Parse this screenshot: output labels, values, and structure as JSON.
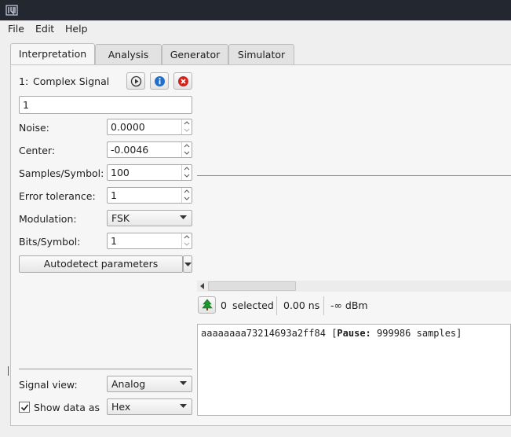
{
  "menubar": {
    "file": "File",
    "edit": "Edit",
    "help": "Help"
  },
  "tabs": [
    "Interpretation",
    "Analysis",
    "Generator",
    "Simulator"
  ],
  "signal": {
    "index": "1:",
    "name": "Complex Signal",
    "name_field_value": "1"
  },
  "params": {
    "noise_label": "Noise:",
    "noise_value": "0.0000",
    "center_label": "Center:",
    "center_value": "-0.0046",
    "samples_label": "Samples/Symbol:",
    "samples_value": "100",
    "error_label": "Error tolerance:",
    "error_value": "1",
    "modulation_label": "Modulation:",
    "modulation_value": "FSK",
    "bits_label": "Bits/Symbol:",
    "bits_value": "1"
  },
  "autodetect_label": "Autodetect parameters",
  "view": {
    "signal_view_label": "Signal view:",
    "signal_view_value": "Analog",
    "show_data_label": "Show data as",
    "show_data_checked": true,
    "show_data_value": "Hex"
  },
  "selection": {
    "count": "0",
    "selected_label": "selected",
    "duration": "0.00 ns",
    "power": "-∞ dBm"
  },
  "output": {
    "hex": "aaaaaaaa73214693a2ff84",
    "pause_prefix": "[",
    "pause_label": "Pause:",
    "pause_value": "999986 samples]"
  },
  "colors": {
    "titlebar": "#232830",
    "play_icon": "#333333",
    "info_icon": "#1e6fd0",
    "close_icon": "#d0241c",
    "crop_icon": "#1a9a2a"
  }
}
